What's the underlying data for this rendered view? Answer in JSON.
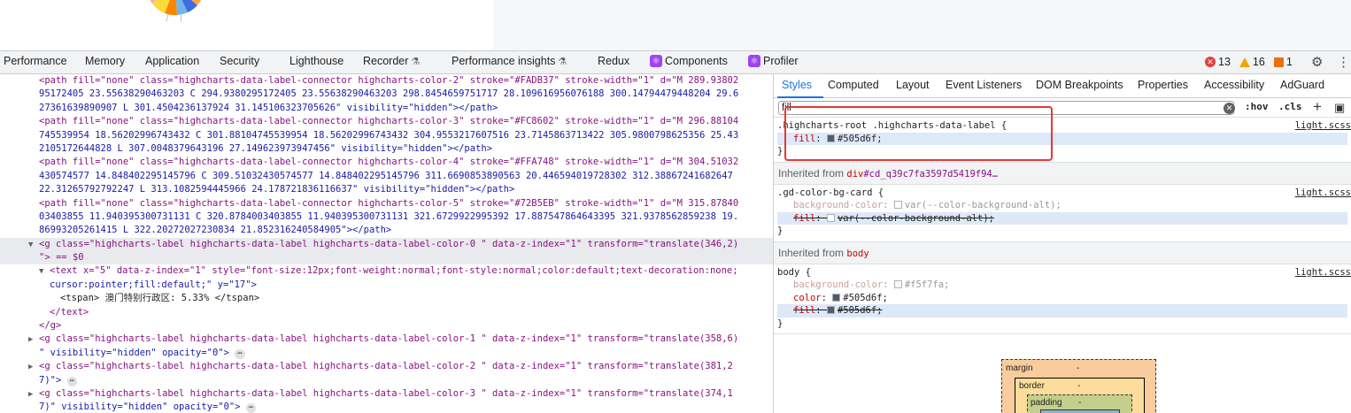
{
  "tabs": [
    {
      "label": "Performance"
    },
    {
      "label": "Memory"
    },
    {
      "label": "Application"
    },
    {
      "label": "Security"
    },
    {
      "label": "Lighthouse"
    },
    {
      "label": "Recorder"
    },
    {
      "label": "Performance insights"
    },
    {
      "label": "Redux"
    },
    {
      "label": "Components"
    },
    {
      "label": "Profiler"
    }
  ],
  "counters": {
    "errors": "13",
    "warnings": "16",
    "issues": "1"
  },
  "elements": {
    "lines": [
      "<path fill=\"none\" class=\"highcharts-data-label-connector highcharts-color-2\" stroke=\"#FADB37\" stroke-width=\"1\" d=\"M 289.93802",
      "95172405 23.55638290463203 C 294.9380295172405 23.55638290463203 298.8454659751717 28.109616956076188 300.14794479448204 29.6",
      "27361639890907 L 301.4504236137924 31.145106323705626\" visibility=\"hidden\"></path>",
      "<path fill=\"none\" class=\"highcharts-data-label-connector highcharts-color-3\" stroke=\"#FC8602\" stroke-width=\"1\" d=\"M 296.88104",
      "745539954 18.56202996743432 C 301.88104745539954 18.56202996743432 304.9553217607516 23.7145863713422 305.9800798625356 25.43",
      "2105172644828 L 307.0048379643196 27.149623973947456\" visibility=\"hidden\"></path>",
      "<path fill=\"none\" class=\"highcharts-data-label-connector highcharts-color-4\" stroke=\"#FFA748\" stroke-width=\"1\" d=\"M 304.51032",
      "430574577 14.848402295145796 C 309.51032430574577 14.848402295145796 311.6690853890563 20.446594019728302 312.38867241682647",
      "22.31265792792247 L 313.1082594445966 24.178721836116637\" visibility=\"hidden\"></path>",
      "<path fill=\"none\" class=\"highcharts-data-label-connector highcharts-color-5\" stroke=\"#72B5EB\" stroke-width=\"1\" d=\"M 315.87840",
      "03403855 11.940395300731131 C 320.8784003403855 11.940395300731131 321.6729922995392 17.887547864643395 321.9378562859238 19.",
      "86993205261415 L 322.20272027230834 21.852316240584905\"></path>",
      "<g class=\"highcharts-label highcharts-data-label highcharts-data-label-color-0 \" data-z-index=\"1\" transform=\"translate(346,2)",
      "\"> == $0",
      "<text x=\"5\" data-z-index=\"1\" style=\"font-size:12px;font-weight:normal;font-style:normal;color:default;text-decoration:none;",
      "cursor:pointer;fill:default;\" y=\"17\">",
      "<tspan> 澳门特别行政区: 5.33% </tspan>",
      "</text>",
      "</g>",
      "<g class=\"highcharts-label highcharts-data-label highcharts-data-label-color-1 \" data-z-index=\"1\" transform=\"translate(358,6)",
      "\" visibility=\"hidden\" opacity=\"0\">",
      "<g class=\"highcharts-label highcharts-data-label highcharts-data-label-color-2 \" data-z-index=\"1\" transform=\"translate(381,2",
      "7)\">",
      "<g class=\"highcharts-label highcharts-data-label highcharts-data-label-color-3 \" data-z-index=\"1\" transform=\"translate(374,1",
      "7)\" visibility=\"hidden\" opacity=\"0\">"
    ]
  },
  "styles": {
    "subtabs": [
      "Styles",
      "Computed",
      "Layout",
      "Event Listeners",
      "DOM Breakpoints",
      "Properties",
      "Accessibility",
      "AdGuard"
    ],
    "filter_value": "fill",
    "hov": ":hov",
    "cls": ".cls",
    "rule1": {
      "selector": ".highcharts-root .highcharts-data-label {",
      "source": "light.scss",
      "prop": "fill",
      "value": "#505d6f;",
      "swatch": "#505d6f"
    },
    "inherited1": {
      "prefix": "Inherited from ",
      "el": "div",
      "id": "#cd_q39c7fa3597d5419f94…"
    },
    "rule2": {
      "selector": ".gd-color-bg-card {",
      "source": "light.scss",
      "p1": "background-color",
      "v1": "var(--color-background-alt);",
      "p2": "fill",
      "v2": "var(--color-background-alt);"
    },
    "inherited2": {
      "prefix": "Inherited from ",
      "el": "body"
    },
    "rule3": {
      "selector": "body {",
      "source": "light.scss",
      "p1": "background-color",
      "v1": "#f5f7fa;",
      "s1": "#f5f7fa",
      "p2": "color",
      "v2": "#505d6f;",
      "s2": "#505d6f",
      "p3": "fill",
      "v3": "#505d6f;",
      "s3": "#505d6f"
    },
    "close_brace": "}",
    "boxmodel": {
      "margin": "margin",
      "border": "border",
      "padding": "padding",
      "dash": "-"
    }
  }
}
